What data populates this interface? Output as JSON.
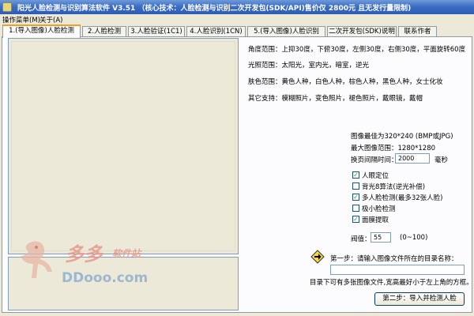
{
  "window": {
    "title": "阳光人脸检测与识别算法软件 V3.51    （核心技术：人脸检测与识别二次开发包(SDK/API)售价仅 2800元 且无发行量限制)"
  },
  "menu": {
    "items": [
      "操作菜单(M)",
      "关于(A)"
    ]
  },
  "tabs": [
    "1.(导入图像)人脸检测",
    "2.人脸检测",
    "3.人脸验证(1C1)",
    "4.人脸识别(1CN)",
    "5.(导入图像)人脸识别",
    "二次开发包(SDK)说明",
    "联系作者"
  ],
  "info_lines": [
    "角度范围：上抑30度，下俯30度，左侧30度，右侧30度，平面旋转60度",
    "光照范围：太阳光，室内光，暗室，逆光",
    "肤色范围：黄色人种，白色人种，棕色人种，黑色人种，女士化妆",
    "其它支持：模糊照片，变色照片，褪色照片，戴眼镜，戴帽"
  ],
  "params": {
    "best_size": "图像最佳为320*240 (BMP或JPG)",
    "max_size": "最大图像范围：1280*1280",
    "interval_label": "换页间隔时间：",
    "interval_value": "2000",
    "interval_unit": "毫秒",
    "threshold_label": "阀值：",
    "threshold_value": "55",
    "threshold_range": "(0~100)"
  },
  "options": [
    {
      "label": "人眼定位",
      "checked": true
    },
    {
      "label": "背光8算法(逆光补偿)",
      "checked": false
    },
    {
      "label": "多人脸检测(最多32张人脸)",
      "checked": true
    },
    {
      "label": "极小脸检测",
      "checked": false
    },
    {
      "label": "面膜提取",
      "checked": true
    }
  ],
  "step1": {
    "label": "第一步：请输入图像文件所在的目录名称：",
    "value": ""
  },
  "hint": "目录下可有多张图像文件,宽高最好小于左上角的方框。",
  "step2_button": "第二步：导入并检测人脸",
  "watermark": {
    "line1": "多多",
    "line2": "软件站",
    "line3": "DDooo.com"
  },
  "colors": {
    "titlebar": "#2c5bb7",
    "active_tab_accent": "#f0a020",
    "check_mark": "#21a121"
  }
}
